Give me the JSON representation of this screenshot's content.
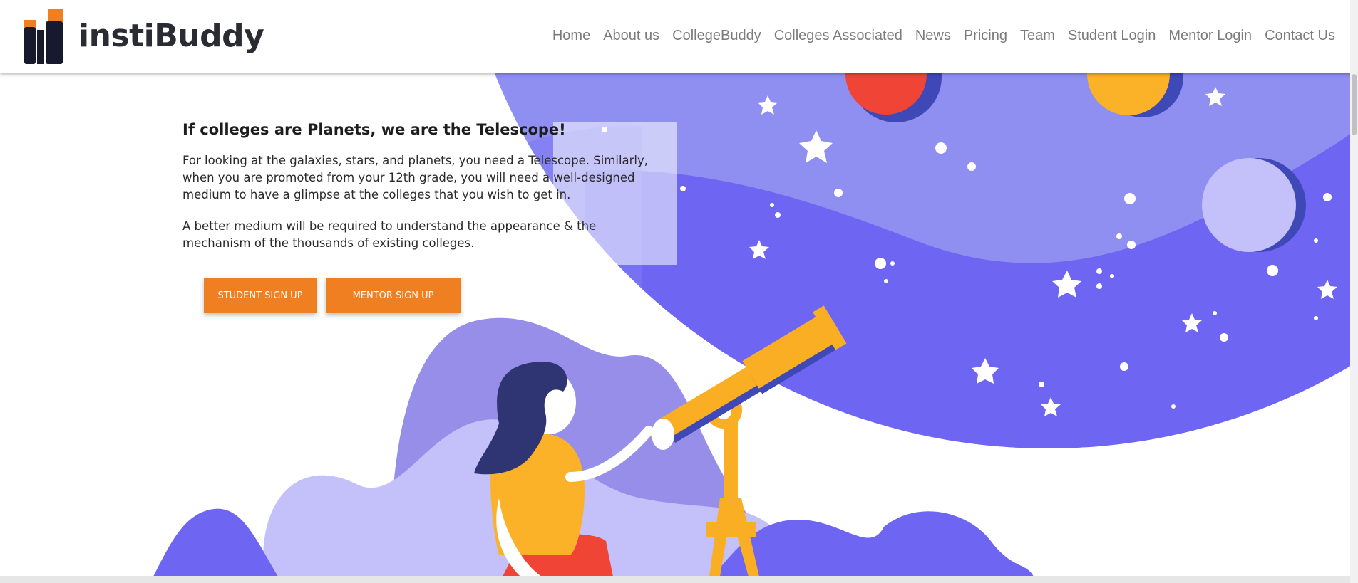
{
  "brand": {
    "name": "instiBuddy"
  },
  "nav": {
    "items": [
      {
        "label": "Home"
      },
      {
        "label": "About us"
      },
      {
        "label": "CollegeBuddy"
      },
      {
        "label": "Colleges Associated"
      },
      {
        "label": "News"
      },
      {
        "label": "Pricing"
      },
      {
        "label": "Team"
      },
      {
        "label": "Student Login"
      },
      {
        "label": "Mentor Login"
      },
      {
        "label": "Contact Us"
      }
    ]
  },
  "hero": {
    "title": "If colleges are Planets, we are the Telescope!",
    "paragraph1": "For looking at the galaxies, stars, and planets, you need a Telescope. Similarly, when you are promoted from your 12th grade, you will need a well-designed medium to have a glimpse at the colleges that you wish to get in.",
    "paragraph2": "A better medium will be required to understand the appearance & the mechanism of the thousands of existing colleges.",
    "student_button": "STUDENT SIGN UP",
    "mentor_button": "MENTOR SIGN UP"
  },
  "illustration": {
    "name": "girl-with-telescope-illustration",
    "colors": {
      "space_light": "#8f8ff2",
      "space_dark": "#6e66f2",
      "planet_red": "#f04436",
      "planet_yellow": "#fbb128",
      "planet_lavender": "#c3c0fa",
      "telescope": "#f9ae24",
      "hair": "#2f3572",
      "shirt": "#fbb128",
      "accent_orange": "#f07f22"
    }
  }
}
